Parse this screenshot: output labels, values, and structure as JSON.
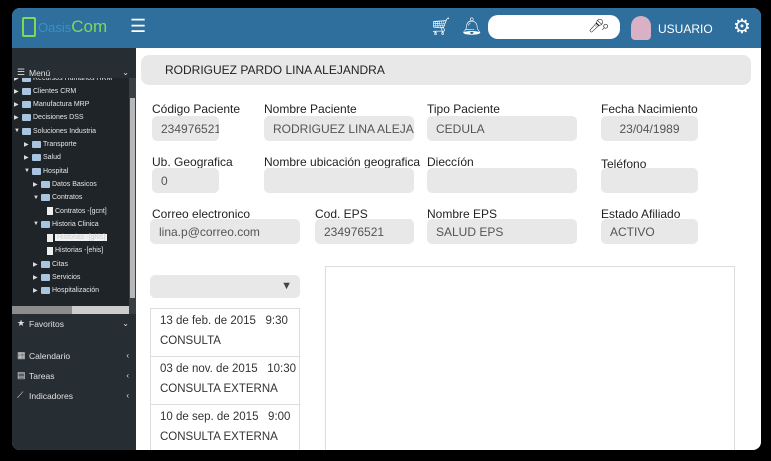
{
  "header": {
    "logo": {
      "prefix": "Oasis",
      "suffix": "Com"
    },
    "icons": [
      "menu-icon",
      "cart-icon",
      "bell-icon",
      "microphone-icon",
      "search-icon",
      "avatar",
      "gear-icon"
    ],
    "search_value": "",
    "user": "USUARIO",
    "color": "#2f6f9d"
  },
  "sidebar": {
    "menu_label": "Menú",
    "tree": [
      {
        "label": "Recursos Humanos HRM",
        "level": 0,
        "type": "folder",
        "state": "collapsed"
      },
      {
        "label": "Clientes CRM",
        "level": 0,
        "type": "folder",
        "state": "collapsed"
      },
      {
        "label": "Manufactura MRP",
        "level": 0,
        "type": "folder",
        "state": "collapsed"
      },
      {
        "label": "Decisiones DSS",
        "level": 0,
        "type": "folder",
        "state": "collapsed"
      },
      {
        "label": "Soluciones Industria",
        "level": 0,
        "type": "folder",
        "state": "expanded"
      },
      {
        "label": "Transporte",
        "level": 1,
        "type": "folder",
        "state": "collapsed"
      },
      {
        "label": "Salud",
        "level": 1,
        "type": "folder",
        "state": "collapsed"
      },
      {
        "label": "Hospital",
        "level": 1,
        "type": "folder",
        "state": "expanded"
      },
      {
        "label": "Datos Basicos",
        "level": 2,
        "type": "folder",
        "state": "collapsed"
      },
      {
        "label": "Contratos",
        "level": 2,
        "type": "folder",
        "state": "expanded"
      },
      {
        "label": "Contratos -[gcnt]",
        "level": 3,
        "type": "file"
      },
      {
        "label": "Historia Clinica",
        "level": 2,
        "type": "folder",
        "state": "expanded"
      },
      {
        "label": "Historias -[ghis]",
        "level": 3,
        "type": "file",
        "selected": true
      },
      {
        "label": "Historias -[ehis]",
        "level": 3,
        "type": "file"
      },
      {
        "label": "Citas",
        "level": 2,
        "type": "folder",
        "state": "collapsed"
      },
      {
        "label": "Servicios",
        "level": 2,
        "type": "folder",
        "state": "collapsed"
      },
      {
        "label": "Hospitalización",
        "level": 2,
        "type": "folder",
        "state": "collapsed"
      }
    ],
    "items": [
      {
        "label": "Favoritos",
        "icon": "star-icon"
      },
      {
        "label": "Calendario",
        "icon": "calendar-icon"
      },
      {
        "label": "Tareas",
        "icon": "tasks-icon"
      },
      {
        "label": "Indicadores",
        "icon": "chart-icon"
      }
    ]
  },
  "main": {
    "title": "RODRIGUEZ PARDO LINA ALEJANDRA",
    "fields": [
      {
        "label": "Código Paciente",
        "value": "234976521"
      },
      {
        "label": "Nombre Paciente",
        "value": "RODRIGUEZ LINA ALEJAN"
      },
      {
        "label": "Tipo Paciente",
        "value": "CEDULA"
      },
      {
        "label": "Fecha Nacimiento",
        "value": "23/04/1989"
      },
      {
        "label": "Ub. Geografica",
        "value": "0"
      },
      {
        "label": "Nombre ubicación geografica",
        "value": ""
      },
      {
        "label": "Dieccíón",
        "value": ""
      },
      {
        "label": "Teléfono",
        "value": ""
      },
      {
        "label": "Correo electronico",
        "value": "lina.p@correo.com"
      },
      {
        "label": "Cod. EPS",
        "value": "234976521"
      },
      {
        "label": "Nombre EPS",
        "value": "SALUD EPS"
      },
      {
        "label": "Estado Afiliado",
        "value": "ACTIVO"
      }
    ],
    "dropdown_value": "",
    "visits": [
      {
        "date": "13 de feb. de 2015   9:30",
        "type": "CONSULTA"
      },
      {
        "date": "03 de nov. de 2015   10:30",
        "type": "CONSULTA EXTERNA"
      },
      {
        "date": "10 de sep. de 2015   9:00",
        "type": "CONSULTA EXTERNA"
      }
    ]
  }
}
